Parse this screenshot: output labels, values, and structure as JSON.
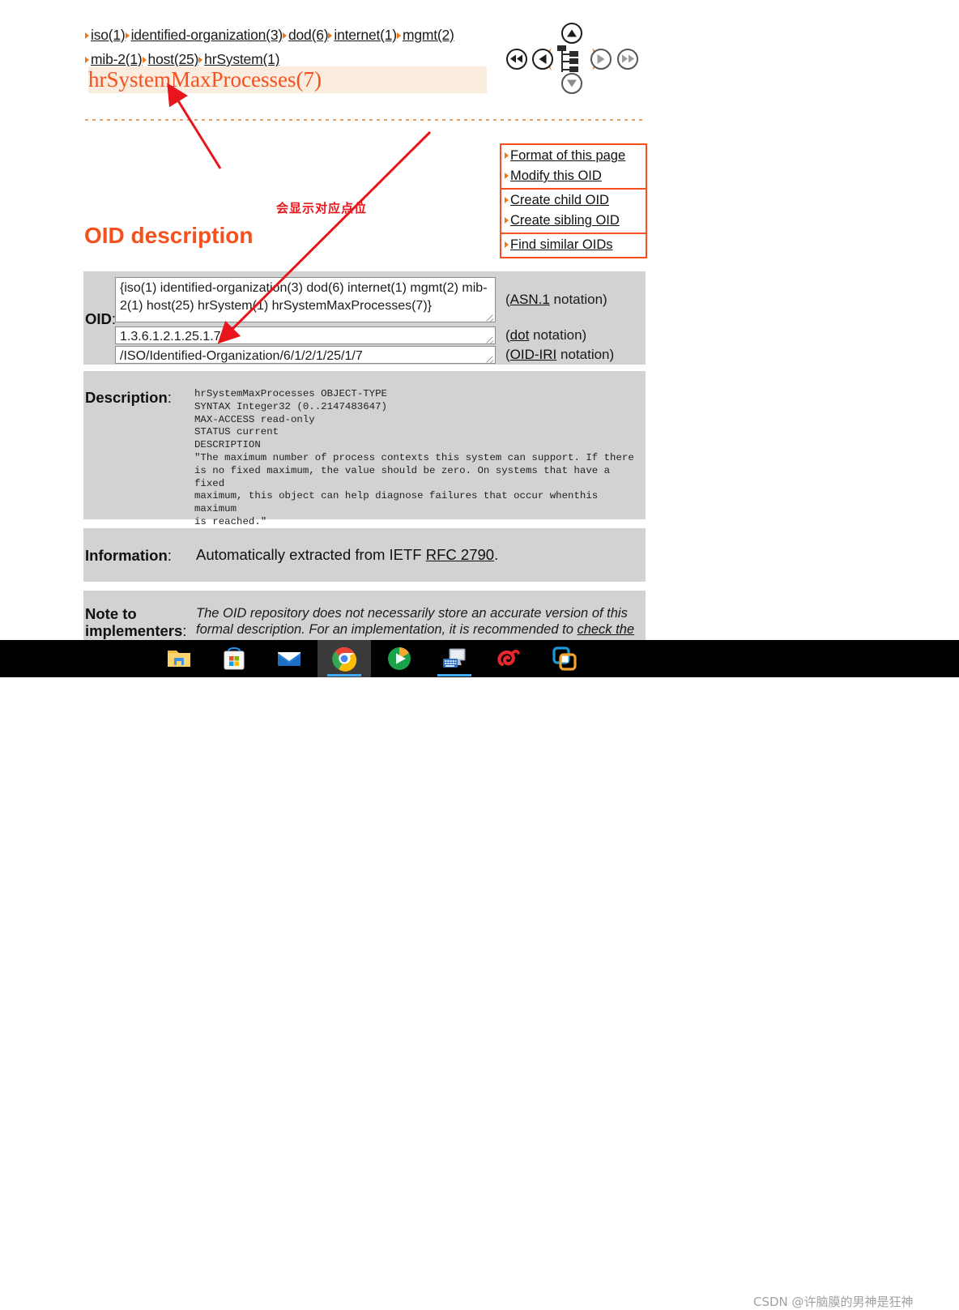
{
  "breadcrumb": {
    "items": [
      {
        "label": "iso(1)"
      },
      {
        "label": "identified-organization(3)"
      },
      {
        "label": "dod(6)"
      },
      {
        "label": "internet(1)"
      },
      {
        "label": "mgmt(2)"
      },
      {
        "label": "mib-2(1)"
      },
      {
        "label": "host(25)"
      },
      {
        "label": "hrSystem(1)"
      }
    ]
  },
  "oid_title": "hrSystemMaxProcesses(7)",
  "navigation": {
    "up": "up-arrow",
    "down": "down-arrow",
    "left": "left-arrow",
    "right": "right-arrow",
    "first": "first-arrow",
    "last": "last-arrow",
    "tree": "tree-icon"
  },
  "actions": {
    "groups": [
      {
        "items": [
          "Format of this page",
          "Modify this OID"
        ]
      },
      {
        "items": [
          "Create child OID",
          "Create sibling OID"
        ]
      },
      {
        "items": [
          "Find similar OIDs"
        ]
      }
    ]
  },
  "headings": {
    "oid_description": "OID description"
  },
  "oid_table": {
    "label": "OID",
    "label_colon": ":",
    "asn1_value": "{iso(1) identified-organization(3) dod(6) internet(1) mgmt(2) mib-2(1) host(25) hrSystem(1) hrSystemMaxProcesses(7)}",
    "dot_value": "1.3.6.1.2.1.25.1.7",
    "iri_value": "/ISO/Identified-Organization/6/1/2/1/25/1/7",
    "notations": {
      "asn1_link": "ASN.1",
      "asn1_rest": " notation)",
      "dot_link": "dot",
      "dot_rest": " notation)",
      "iri_link": "OID-IRI",
      "iri_rest": " notation)",
      "open_paren": "("
    }
  },
  "description": {
    "label": "Description",
    "label_colon": ":",
    "text": "hrSystemMaxProcesses OBJECT-TYPE\nSYNTAX Integer32 (0..2147483647)\nMAX-ACCESS read-only\nSTATUS current\nDESCRIPTION\n\"The maximum number of process contexts this system can support. If there\nis no fixed maximum, the value should be zero. On systems that have a fixed\nmaximum, this object can help diagnose failures that occur whenthis maximum\nis reached.\""
  },
  "information": {
    "label": "Information",
    "label_colon": ":",
    "text_before": "Automatically extracted from IETF ",
    "link": "RFC 2790",
    "text_after": "."
  },
  "note": {
    "label_line1": "Note to",
    "label_line2": "implementers",
    "label_colon": ":",
    "text_before": "The OID repository does not necessarily store an accurate version of this formal description. For an implementation, it is recommended to ",
    "link": "check the"
  },
  "annotations": {
    "chinese_note": "会显示对应点位",
    "arrow_color": "#e8161c"
  },
  "taskbar": {
    "items": [
      {
        "name": "file-explorer",
        "label": "File Explorer"
      },
      {
        "name": "microsoft-store",
        "label": "Microsoft Store"
      },
      {
        "name": "mail",
        "label": "Mail"
      },
      {
        "name": "google-chrome",
        "label": "Google Chrome"
      },
      {
        "name": "media-player",
        "label": "Media Player"
      },
      {
        "name": "remote-desktop",
        "label": "Remote Desktop"
      },
      {
        "name": "snail-app",
        "label": "Snail App"
      },
      {
        "name": "vmware",
        "label": "VMware"
      }
    ]
  },
  "watermark": "CSDN @许脑膜的男神是狂神",
  "colors": {
    "accent_orange": "#f4511e",
    "title_bg": "#fbece0",
    "table_bg": "#d2d2d2",
    "annotation_red": "#e8161c"
  }
}
